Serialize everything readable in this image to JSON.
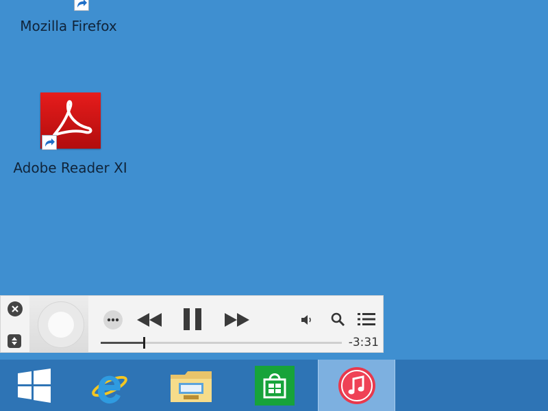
{
  "desktop": {
    "icons": [
      {
        "label": "Mozilla Firefox",
        "icon": "firefox-icon"
      },
      {
        "label": "Adobe Reader XI",
        "icon": "adobe-reader-icon"
      }
    ],
    "background": "#3f8fd0"
  },
  "mini_player": {
    "time_remaining": "-3:31",
    "progress": 0.18,
    "controls": [
      "close-icon",
      "expand-icon",
      "more-icon",
      "rewind-icon",
      "pause-icon",
      "fast-forward-icon",
      "volume-icon",
      "search-icon",
      "up-next-list-icon"
    ]
  },
  "taskbar": {
    "items": [
      "windows-start-icon",
      "internet-explorer-icon",
      "file-explorer-icon",
      "windows-store-icon",
      "itunes-icon"
    ],
    "active": "itunes-icon",
    "color": "#2e74b5"
  }
}
